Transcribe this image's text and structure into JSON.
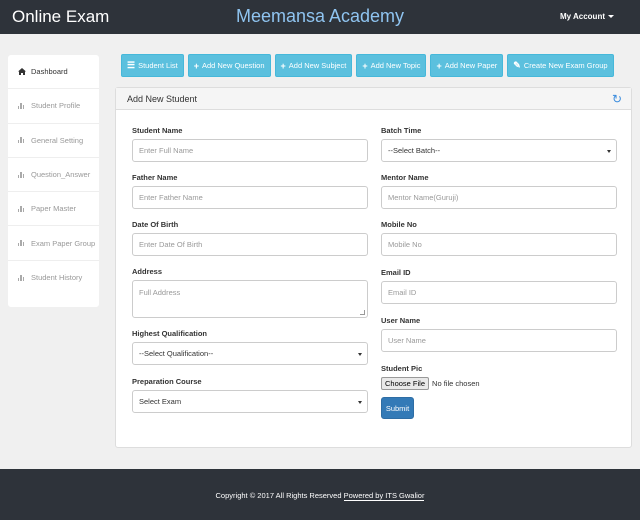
{
  "header": {
    "brand": "Online Exam",
    "academy": "Meemansa Academy",
    "account_label": "My Account"
  },
  "sidebar": {
    "items": [
      {
        "label": "Dashboard",
        "icon": "home-icon",
        "active": true
      },
      {
        "label": "Student Profile",
        "icon": "bar-chart-icon",
        "active": false
      },
      {
        "label": "General Setting",
        "icon": "bar-chart-icon",
        "active": false
      },
      {
        "label": "Question_Answer",
        "icon": "bar-chart-icon",
        "active": false
      },
      {
        "label": "Paper Master",
        "icon": "bar-chart-icon",
        "active": false
      },
      {
        "label": "Exam Paper Group",
        "icon": "bar-chart-icon",
        "active": false
      },
      {
        "label": "Student History",
        "icon": "bar-chart-icon",
        "active": false
      }
    ]
  },
  "toolbar": {
    "student_list": "Student List",
    "add_question": "Add New Question",
    "add_subject": "Add New Subject",
    "add_topic": "Add New Topic",
    "add_paper": "Add New Paper",
    "create_group": "Create New Exam Group"
  },
  "panel": {
    "title": "Add New Student"
  },
  "form": {
    "student_name": {
      "label": "Student Name",
      "placeholder": "Enter Full Name"
    },
    "father_name": {
      "label": "Father Name",
      "placeholder": "Enter Father Name"
    },
    "dob": {
      "label": "Date Of Birth",
      "placeholder": "Enter Date Of Birth"
    },
    "address": {
      "label": "Address",
      "placeholder": "Full Address"
    },
    "qualification": {
      "label": "Highest Qualification",
      "selected": "--Select Qualification--"
    },
    "course": {
      "label": "Preparation Course",
      "selected": "Select Exam"
    },
    "batch_time": {
      "label": "Batch Time",
      "selected": "--Select Batch--"
    },
    "mentor_name": {
      "label": "Mentor Name",
      "placeholder": "Mentor Name(Guruji)"
    },
    "mobile": {
      "label": "Mobile No",
      "placeholder": "Mobile No"
    },
    "email": {
      "label": "Email ID",
      "placeholder": "Email ID"
    },
    "username": {
      "label": "User Name",
      "placeholder": "User Name"
    },
    "student_pic": {
      "label": "Student Pic",
      "button": "Choose File",
      "status": "No file chosen"
    },
    "submit": "Submit"
  },
  "footer": {
    "text": "Copyright © 2017 All Rights Reserved ",
    "powered": "Powered by ITS Gwalior"
  },
  "colors": {
    "topbar": "#2e333a",
    "academy": "#8fc4f0",
    "toolbar_button": "#5bc0de",
    "submit_button": "#337ab7"
  }
}
